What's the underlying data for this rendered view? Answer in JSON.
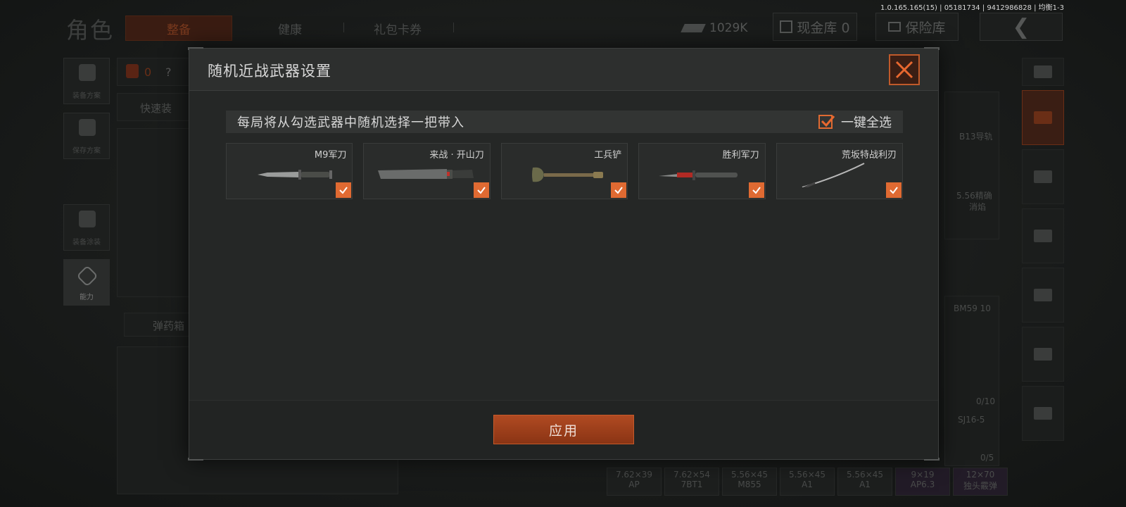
{
  "version": "1.0.165.165(15) | 05181734 | 9412986828 | 均衡1-3",
  "topbar": {
    "title": "角色",
    "tabs": [
      {
        "label": "整备",
        "active": true
      },
      {
        "label": "健康",
        "active": false
      },
      {
        "label": "礼包卡券",
        "active": false
      }
    ],
    "currency": "1029K",
    "cash_vault": "现金库 0",
    "insurance_vault": "保险库"
  },
  "left_nav": [
    {
      "label": "装备方案"
    },
    {
      "label": "保存方案"
    },
    {
      "label": "装备涂装"
    },
    {
      "label": "能力"
    }
  ],
  "background": {
    "weight_value": "0",
    "help": "?",
    "quick_equip": "快速装",
    "ammo_box": "弹药箱",
    "right_labels": [
      "B13导轨",
      "5.56精确",
      "消焰",
      "BM59 10",
      "0/10",
      "SJ16-5",
      "0/5"
    ],
    "ammo": [
      "7.62×39",
      "7.62×54",
      "5.56×45",
      "5.56×45",
      "5.56×45",
      "9×19",
      "12×70"
    ],
    "ammo_sub": [
      "AP",
      "7BT1",
      "M855",
      "A1",
      "A1",
      "AP6.3",
      "独头霰弹"
    ]
  },
  "modal": {
    "title": "随机近战武器设置",
    "info": "每局将从勾选武器中随机选择一把带入",
    "select_all_label": "一键全选",
    "select_all_checked": true,
    "apply_label": "应用",
    "weapons": [
      {
        "name": "M9军刀",
        "checked": true
      },
      {
        "name": "来战 · 开山刀",
        "checked": true
      },
      {
        "name": "工兵铲",
        "checked": true
      },
      {
        "name": "胜利军刀",
        "checked": true
      },
      {
        "name": "荒坂特战利刃",
        "checked": true
      }
    ]
  },
  "colors": {
    "accent": "#e06a32",
    "apply": "#a8421b",
    "panel": "#252726"
  }
}
